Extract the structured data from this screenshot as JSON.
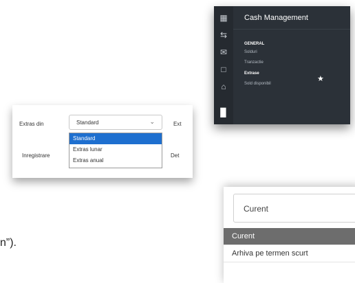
{
  "nav": {
    "title": "Cash Management",
    "section": "GENERAL",
    "items": [
      {
        "label": "Solduri",
        "active": false
      },
      {
        "label": "Tranzactie",
        "active": false
      },
      {
        "label": "Extrase",
        "active": true
      },
      {
        "label": "Sold disponibil",
        "active": false
      }
    ],
    "rail_icons": [
      "dashboard-icon",
      "transfer-icon",
      "mail-icon",
      "clipboard-icon",
      "bank-icon",
      "bar-chart-icon"
    ],
    "star_icon": "star-icon"
  },
  "extras_form": {
    "label": "Extras din",
    "selected_value": "Standard",
    "options": [
      "Standard",
      "Extras lunar",
      "Extras anual"
    ],
    "selected_index": 0,
    "column_header": "Inregistrare",
    "partial_right_label": "Ext",
    "partial_right_header": "Det"
  },
  "archive_form": {
    "selected_value": "Curent",
    "options": [
      "Curent",
      "Arhiva pe termen scurt"
    ],
    "selected_index": 0
  },
  "text_fragment": "n”).",
  "colors": {
    "nav_bg": "#2b3138",
    "select_highlight": "#1e6fcf",
    "archive_highlight": "#6d6d6d"
  }
}
